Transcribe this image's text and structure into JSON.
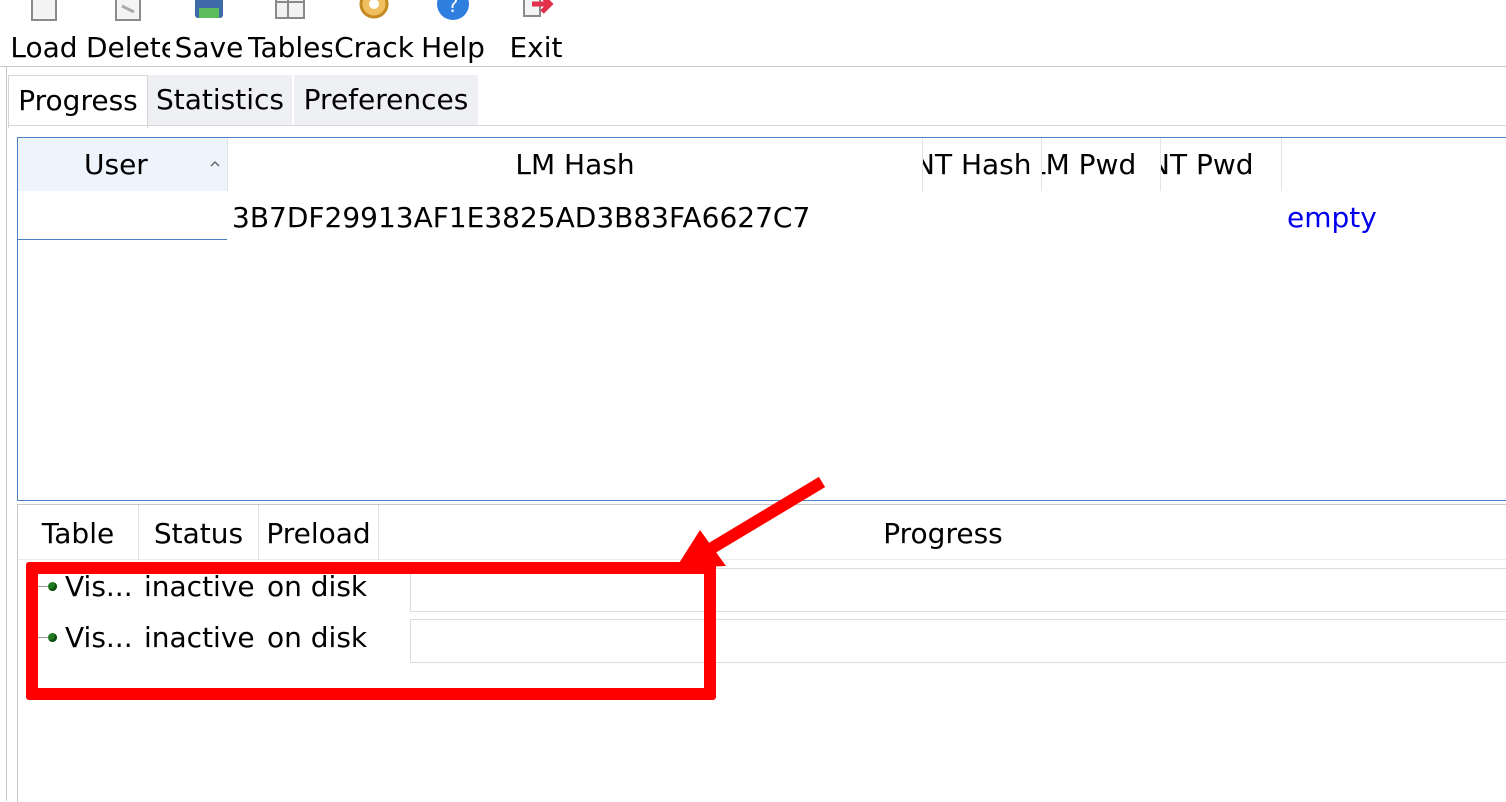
{
  "toolbar": {
    "buttons": [
      {
        "label": "Load",
        "icon": "load-icon"
      },
      {
        "label": "Delete",
        "icon": "delete-icon"
      },
      {
        "label": "Save",
        "icon": "save-icon"
      },
      {
        "label": "Tables",
        "icon": "tables-icon"
      },
      {
        "label": "Crack",
        "icon": "crack-icon"
      },
      {
        "label": "Help",
        "icon": "help-icon"
      },
      {
        "label": "Exit",
        "icon": "exit-icon"
      }
    ]
  },
  "tabs": [
    {
      "label": "Progress",
      "active": true
    },
    {
      "label": "Statistics",
      "active": false
    },
    {
      "label": "Preferences",
      "active": false
    }
  ],
  "hash_list": {
    "columns": [
      "User",
      "LM Hash",
      "NT Hash",
      "LM Pwd",
      "NT Pwd",
      ""
    ],
    "sorted_column": "User",
    "rows": [
      {
        "user": "",
        "lm_hash": "3B7DF29913AF1E3825AD3B83FA6627C7",
        "nt_hash": "",
        "lm_pwd": "",
        "nt_pwd": "",
        "status": "empty"
      }
    ]
  },
  "tables_list": {
    "columns": [
      "Table",
      "Status",
      "Preload",
      "Progress"
    ],
    "rows": [
      {
        "table": "Vis...",
        "status": "inactive",
        "preload": "on disk",
        "progress": 0
      },
      {
        "table": "Vis...",
        "status": "inactive",
        "preload": "on disk",
        "progress": 0
      }
    ]
  },
  "colors": {
    "annotation": "#ff0000",
    "accent_border": "#4a7fc1",
    "empty_text": "#0000ee",
    "status_dot": "#1f7a1f"
  }
}
